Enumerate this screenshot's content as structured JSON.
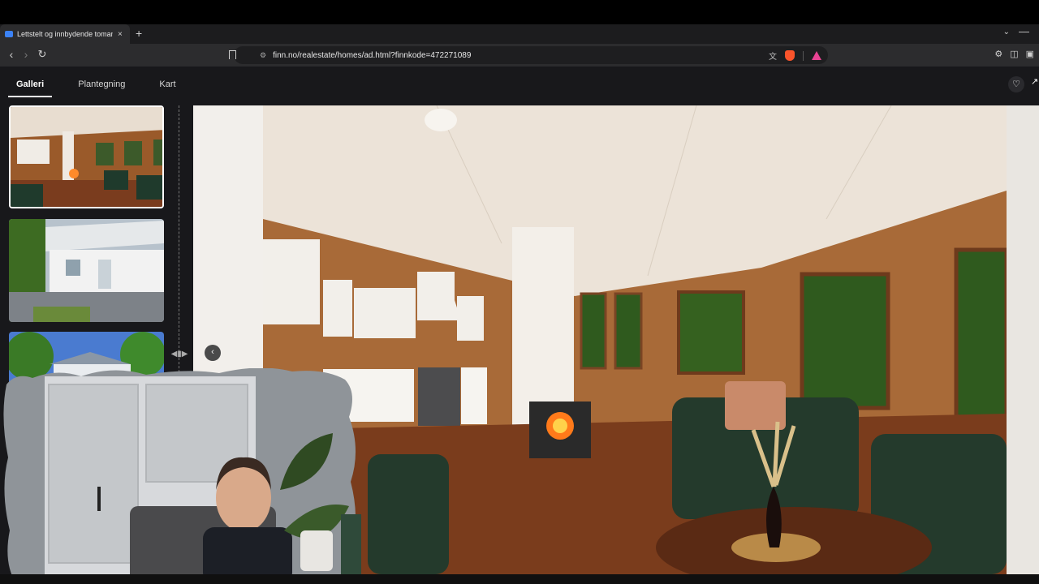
{
  "browser": {
    "tab_title": "Lettstelt og innbydende tomannsbolig",
    "new_tab_symbol": "+",
    "close_symbol": "×",
    "url": "finn.no/realestate/homes/ad.html?finnkode=472271089"
  },
  "page": {
    "tabs": [
      {
        "label": "Galleri",
        "active": true
      },
      {
        "label": "Plantegning",
        "active": false
      },
      {
        "label": "Kart",
        "active": false
      }
    ]
  },
  "gallery": {
    "thumbnails": [
      {
        "subject": "living room with kitchen and wood stove",
        "selected": true
      },
      {
        "subject": "white house exterior with porch",
        "selected": false
      },
      {
        "subject": "house exterior with trees and blue sky",
        "selected": false
      }
    ],
    "main_image_subject": "open living room with kitchen, wood stove, green armchairs and windows"
  },
  "colors": {
    "page_bg": "#18181b",
    "accent": "#ffffff"
  },
  "icons": [
    "back-icon",
    "forward-icon",
    "reload-icon",
    "bookmark-icon",
    "site-info-icon",
    "translate-icon",
    "brave-shields-icon",
    "brave-rewards-icon",
    "extensions-icon",
    "sidebar-icon",
    "wallet-icon",
    "heart-icon",
    "share-icon",
    "chevron-left-icon",
    "drag-handle-icon"
  ]
}
